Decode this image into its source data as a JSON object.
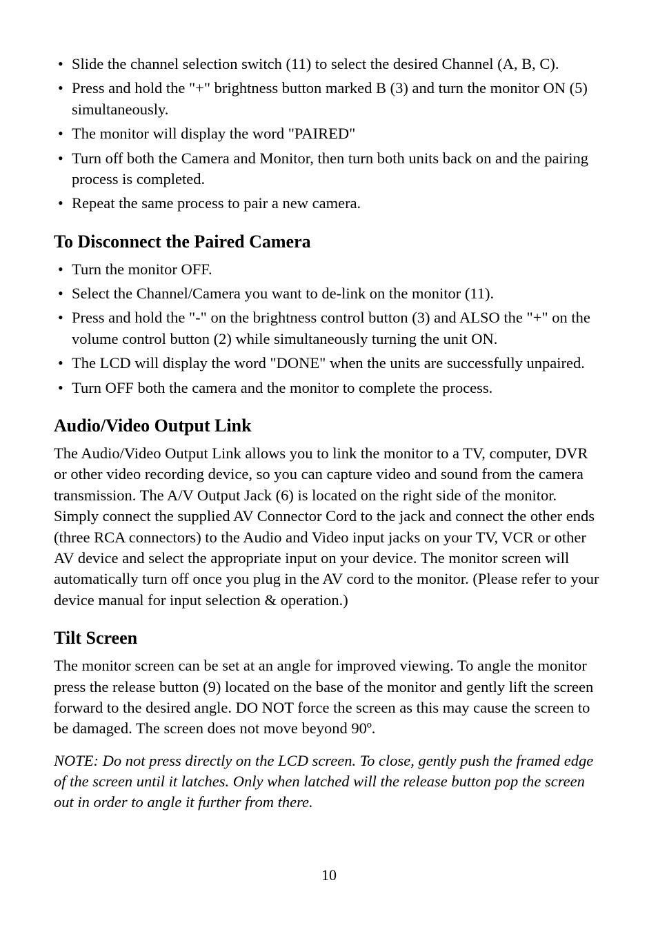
{
  "topList": {
    "items": [
      "Slide the channel selection switch (11) to select the desired Channel (A, B, C).",
      "Press and hold the \"+\" brightness button marked B (3) and turn the monitor ON (5) simultaneously.",
      "The monitor will display the word \"PAIRED\"",
      "Turn off both the Camera and Monitor, then turn both units back on and the pairing process is completed.",
      "Repeat the same process to pair a new camera."
    ]
  },
  "section1": {
    "heading": "To Disconnect the Paired Camera",
    "items": [
      "Turn the monitor OFF.",
      "Select the Channel/Camera you want to de-link on the monitor (11).",
      "Press and hold the \"-\" on the brightness control button (3) and ALSO the \"+\" on the volume control button (2) while simultaneously turning the unit ON.",
      "The LCD will display the word \"DONE\" when the units are successfully unpaired.",
      "Turn OFF both the camera and the monitor to complete the process."
    ]
  },
  "section2": {
    "heading": "Audio/Video Output Link",
    "body": "The Audio/Video Output Link allows you to link the monitor to a TV, computer, DVR or other video recording device, so you can capture video and sound from the camera transmission. The A/V Output Jack (6) is located on the right side of the monitor. Simply connect the supplied AV Connector Cord to the jack and connect the other ends (three RCA connectors) to the Audio and Video input jacks on your TV, VCR or other AV device and select the appropriate input on your device. The monitor screen will automatically turn off once you plug in the AV cord to the monitor. (Please refer to your device manual for input selection & operation.)"
  },
  "section3": {
    "heading": "Tilt Screen",
    "body": "The monitor screen can be set at an angle for improved viewing. To angle the monitor press the release button (9) located on the base of the monitor and gently lift the screen forward to the desired angle. DO NOT force the screen as this may cause the screen to be damaged. The screen does not move beyond 90º.",
    "note": "NOTE: Do not press directly on the LCD screen. To close, gently push the framed edge of the screen until it latches. Only when latched will the release button pop the screen out in order to angle it further from there."
  },
  "pageNumber": "10"
}
